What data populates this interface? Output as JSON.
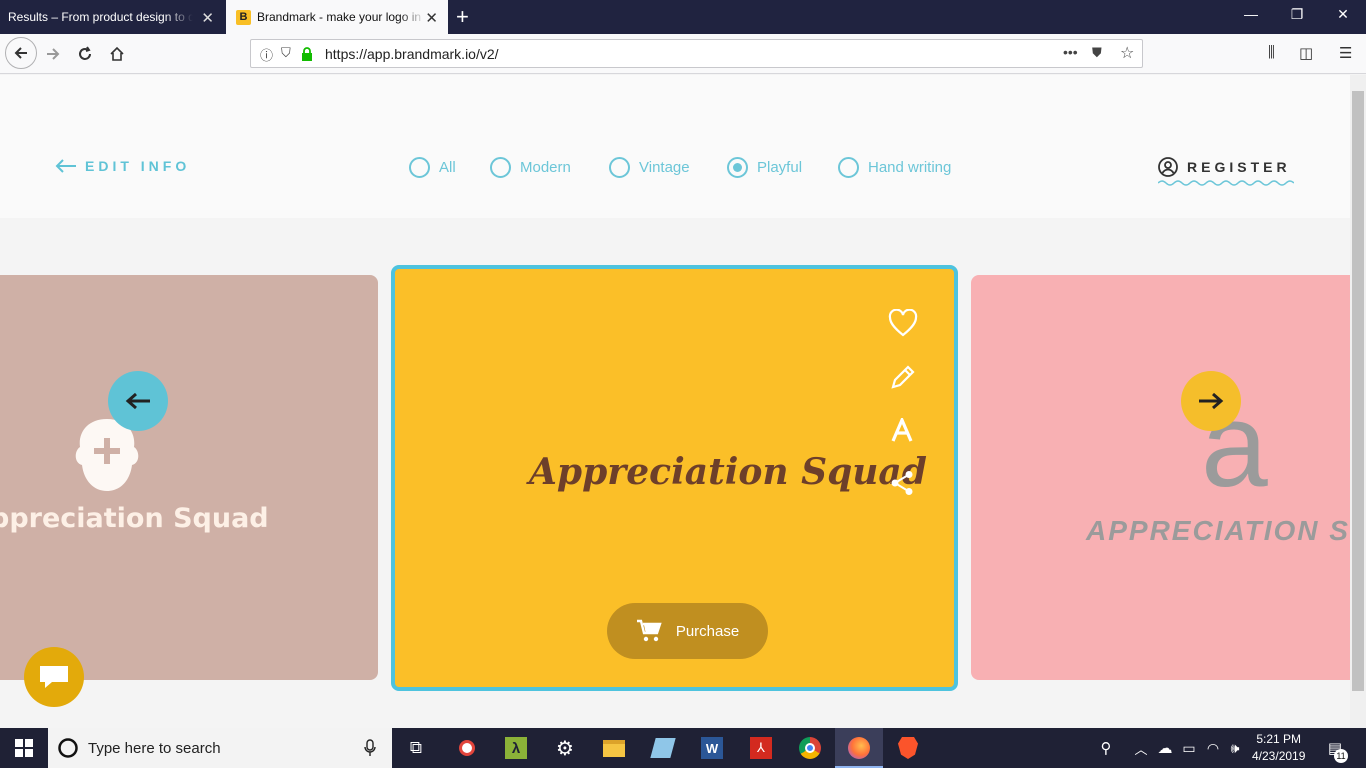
{
  "browser": {
    "tabs": [
      {
        "title": "Results – From product design to di",
        "close": "✕"
      },
      {
        "favicon": "B",
        "title": "Brandmark - make your logo in",
        "close": "✕"
      }
    ],
    "new_tab": "+",
    "window_controls": {
      "minimize": "—",
      "restore": "❐",
      "close": "✕"
    },
    "url": "https://app.brandmark.io/v2/",
    "url_more": "•••"
  },
  "header": {
    "edit_info": "EDIT INFO",
    "styles": [
      {
        "label": "All",
        "selected": false
      },
      {
        "label": "Modern",
        "selected": false
      },
      {
        "label": "Vintage",
        "selected": false
      },
      {
        "label": "Playful",
        "selected": true
      },
      {
        "label": "Hand writing",
        "selected": false
      }
    ],
    "register": "REGISTER"
  },
  "cards": {
    "left": {
      "logo_text": "ppreciation Squad",
      "color": "#cfb0a6"
    },
    "center": {
      "logo_text": "Appreciation Squad",
      "color": "#fbbf28",
      "purchase_label": "Purchase"
    },
    "right": {
      "logo_mark": "a",
      "logo_text": "APPRECIATION SQUAD",
      "color": "#f8b0b3"
    }
  },
  "colors": {
    "accent": "#5fc3d6",
    "selected_border": "#4ec3de"
  },
  "taskbar": {
    "search_placeholder": "Type here to search",
    "time": "5:21 PM",
    "date": "4/23/2019",
    "notification_count": "11"
  }
}
